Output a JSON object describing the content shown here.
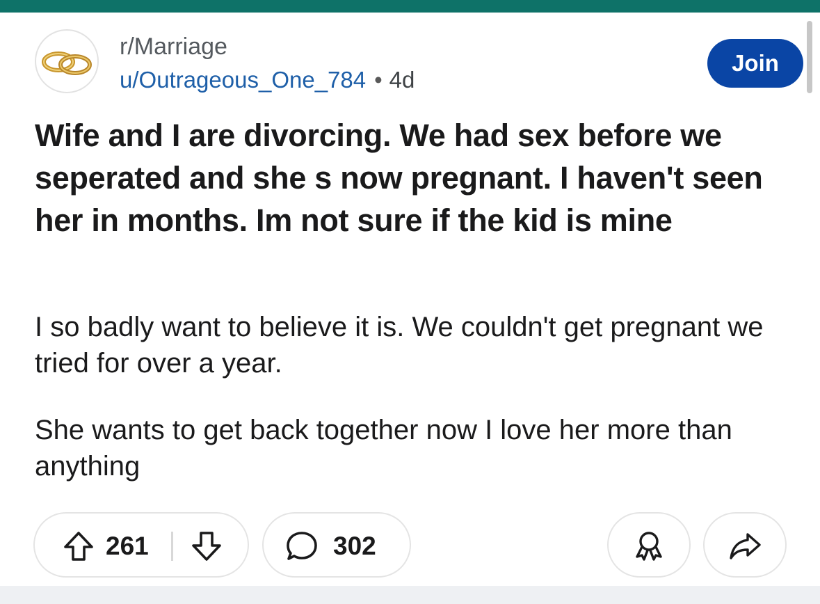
{
  "colors": {
    "top_bar": "#0e7268",
    "join_button": "#0a45a5",
    "author_link": "#1e5fa8"
  },
  "header": {
    "avatar_icon": "wedding-rings-icon",
    "subreddit": "r/Marriage",
    "author": "u/Outrageous_One_784",
    "separator": "•",
    "age": "4d",
    "join_label": "Join"
  },
  "post": {
    "title": "Wife and I are divorcing. We had sex before we seperated and she s now pregnant. I haven't seen her in months. Im not sure if the kid is mine",
    "paragraphs": [
      "I so badly want to believe it is. We couldn't get pregnant we tried for over a year.",
      "She wants to get back together now I love her more than anything"
    ]
  },
  "actions": {
    "upvote_icon": "arrow-up-icon",
    "votes": "261",
    "downvote_icon": "arrow-down-icon",
    "comment_icon": "speech-bubble-icon",
    "comments": "302",
    "award_icon": "award-ribbon-icon",
    "share_icon": "share-arrow-icon"
  }
}
